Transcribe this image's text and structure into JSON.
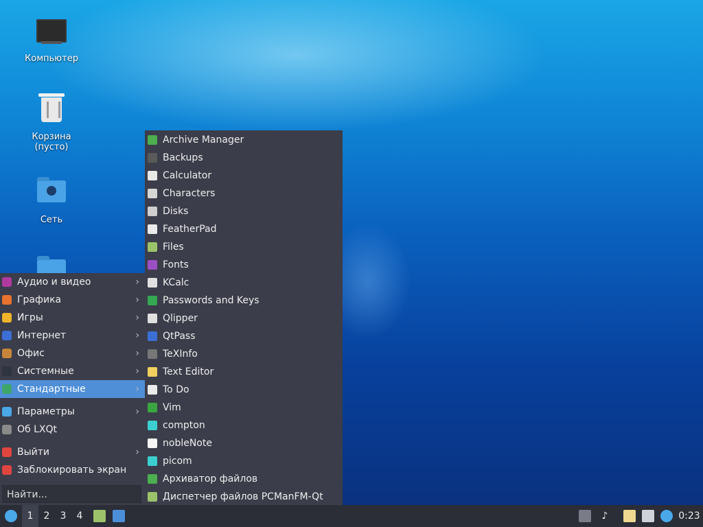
{
  "desktop": {
    "icons": [
      {
        "label": "Компьютер",
        "icon": "computer-icon"
      },
      {
        "label": "Корзина (пусто)",
        "icon": "trash-icon"
      },
      {
        "label": "Сеть",
        "icon": "network-folder-icon"
      },
      {
        "label": "",
        "icon": "folder-icon"
      }
    ]
  },
  "main_menu": {
    "categories": [
      {
        "label": "Аудио и видео",
        "icon": "multimedia-icon",
        "color": "#b03aa0"
      },
      {
        "label": "Графика",
        "icon": "graphics-icon",
        "color": "#e8722e"
      },
      {
        "label": "Игры",
        "icon": "games-icon",
        "color": "#f0b429"
      },
      {
        "label": "Интернет",
        "icon": "internet-icon",
        "color": "#3c6fd6"
      },
      {
        "label": "Офис",
        "icon": "office-icon",
        "color": "#c7853a"
      },
      {
        "label": "Системные",
        "icon": "system-icon",
        "color": "#2e3440"
      },
      {
        "label": "Стандартные",
        "icon": "accessories-icon",
        "color": "#3fa66a",
        "selected": true
      }
    ],
    "settings": [
      {
        "label": "Параметры",
        "icon": "preferences-icon",
        "color": "#4aa8e8",
        "has_arrow": true
      },
      {
        "label": "Об LXQt",
        "icon": "about-icon",
        "color": "#8a8a8a",
        "has_arrow": false
      }
    ],
    "session": [
      {
        "label": "Выйти",
        "icon": "power-icon",
        "color": "#e0463f",
        "has_arrow": true
      },
      {
        "label": "Заблокировать экран",
        "icon": "lock-icon",
        "color": "#e0463f",
        "has_arrow": false
      }
    ],
    "search_placeholder": "Найти..."
  },
  "submenu": {
    "items": [
      {
        "label": "Archive Manager",
        "icon": "archive-icon",
        "color": "#4caf50"
      },
      {
        "label": "Backups",
        "icon": "backups-icon",
        "color": "#5a5a5a"
      },
      {
        "label": "Calculator",
        "icon": "calculator-icon",
        "color": "#e8e8e8"
      },
      {
        "label": "Characters",
        "icon": "characters-icon",
        "color": "#d6d6d6"
      },
      {
        "label": "Disks",
        "icon": "disks-icon",
        "color": "#cfcfcf"
      },
      {
        "label": "FeatherPad",
        "icon": "featherpad-icon",
        "color": "#eaeaea"
      },
      {
        "label": "Files",
        "icon": "files-icon",
        "color": "#9cc26a"
      },
      {
        "label": "Fonts",
        "icon": "fonts-icon",
        "color": "#9b4fc4"
      },
      {
        "label": "KCalc",
        "icon": "kcalc-icon",
        "color": "#e0e0e0"
      },
      {
        "label": "Passwords and Keys",
        "icon": "passwords-icon",
        "color": "#35a853"
      },
      {
        "label": "Qlipper",
        "icon": "qlipper-icon",
        "color": "#e0e0e0"
      },
      {
        "label": "QtPass",
        "icon": "qtpass-icon",
        "color": "#3c6fd6"
      },
      {
        "label": "TeXInfo",
        "icon": "texinfo-icon",
        "color": "#777777"
      },
      {
        "label": "Text Editor",
        "icon": "text-editor-icon",
        "color": "#f0d060"
      },
      {
        "label": "To Do",
        "icon": "todo-icon",
        "color": "#eaeaea"
      },
      {
        "label": "Vim",
        "icon": "vim-icon",
        "color": "#3aa640"
      },
      {
        "label": "compton",
        "icon": "compton-icon",
        "color": "#3ccfcf"
      },
      {
        "label": "nobleNote",
        "icon": "noblenote-icon",
        "color": "#f5f5f5"
      },
      {
        "label": "picom",
        "icon": "picom-icon",
        "color": "#3ccfcf"
      },
      {
        "label": "Архиватор файлов",
        "icon": "archiver-icon",
        "color": "#4caf50"
      },
      {
        "label": "Диспетчер файлов PCManFM-Qt",
        "icon": "file-manager-icon",
        "color": "#9cc26a"
      }
    ]
  },
  "taskbar": {
    "workspaces": [
      "1",
      "2",
      "3",
      "4"
    ],
    "active_workspace": "1",
    "clock": "0:23",
    "tray_icons": [
      "eject-icon",
      "volume-icon",
      "clipboard-icon",
      "network-icon",
      "update-notifier-icon"
    ]
  }
}
